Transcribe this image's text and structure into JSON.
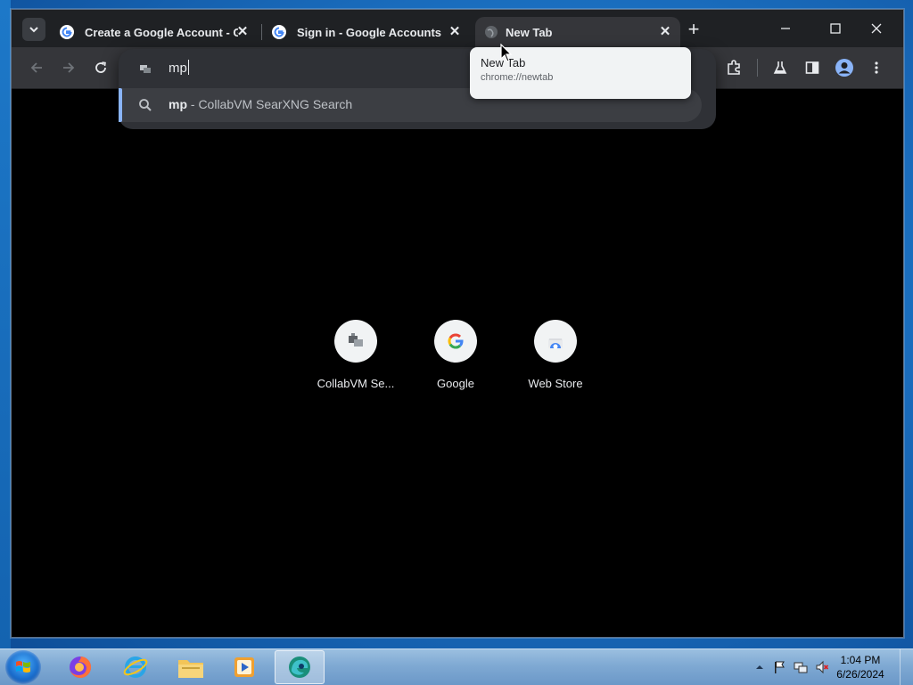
{
  "browser": {
    "tabs": [
      {
        "title": "Create a Google Account - Goo",
        "favicon": "google-g-icon",
        "active": false
      },
      {
        "title": "Sign in - Google Accounts",
        "favicon": "google-g-icon",
        "active": false
      },
      {
        "title": "New Tab",
        "favicon": "globe-icon",
        "active": true
      }
    ],
    "hover_card": {
      "title": "New Tab",
      "url": "chrome://newtab"
    },
    "omnibox": {
      "value": "mp",
      "suggestion_query": "mp",
      "suggestion_rest": " - CollabVM SearXNG Search"
    },
    "shortcuts": [
      {
        "label": "CollabVM Se...",
        "icon": "collabvm-icon"
      },
      {
        "label": "Google",
        "icon": "google-g-icon"
      },
      {
        "label": "Web Store",
        "icon": "web-store-icon"
      }
    ]
  },
  "taskbar": {
    "apps": [
      "firefox-icon",
      "internet-explorer-icon",
      "file-explorer-icon",
      "media-player-icon",
      "edge-icon"
    ],
    "clock_time": "1:04 PM",
    "clock_date": "6/26/2024"
  },
  "colors": {
    "accent": "#8ab4f8",
    "toolbar": "#35363a",
    "tabstrip": "#1f2124"
  }
}
